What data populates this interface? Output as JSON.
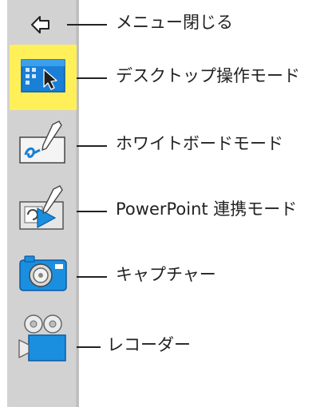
{
  "toolbar": {
    "items": [
      {
        "id": "close-menu",
        "icon": "back-arrow-icon",
        "label": "メニュー閉じる"
      },
      {
        "id": "desktop",
        "icon": "desktop-pointer-icon",
        "label": "デスクトップ操作モード",
        "active": true
      },
      {
        "id": "whiteboard",
        "icon": "whiteboard-pen-icon",
        "label": "ホワイトボードモード"
      },
      {
        "id": "powerpoint",
        "icon": "powerpoint-pen-icon",
        "label": "PowerPoint 連携モード"
      },
      {
        "id": "capture",
        "icon": "camera-icon",
        "label": "キャプチャー"
      },
      {
        "id": "recorder",
        "icon": "video-camera-icon",
        "label": "レコーダー"
      }
    ]
  },
  "colors": {
    "toolbar_bg": "#d2d2d2",
    "active_highlight": "#fff05a",
    "icon_blue": "#1a8fe0"
  }
}
